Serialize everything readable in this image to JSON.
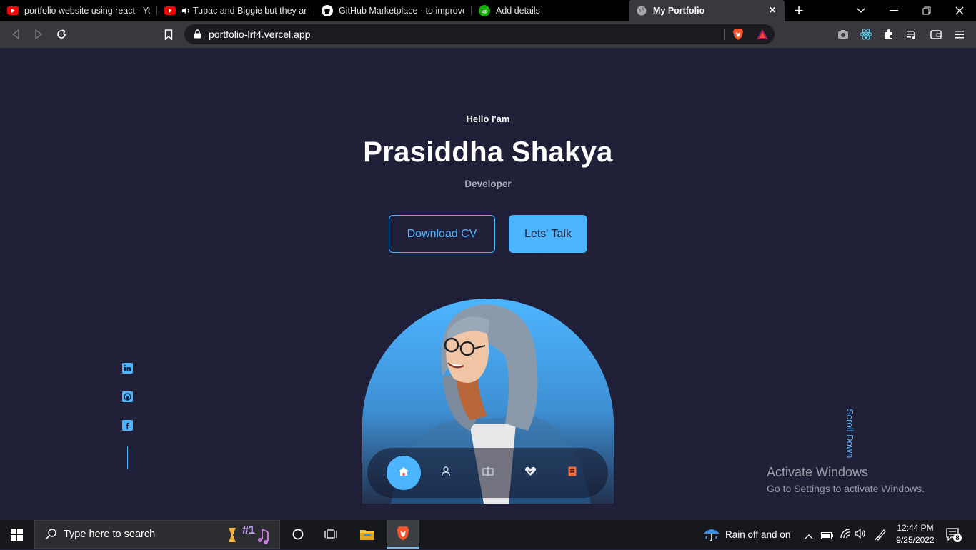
{
  "browser": {
    "tabs": [
      {
        "title": "portfolio website using react - You",
        "icon": "youtube-icon",
        "audio": false,
        "active": false
      },
      {
        "title": "Tupac and Biggie but they are",
        "icon": "youtube-icon",
        "audio": true,
        "active": false
      },
      {
        "title": "GitHub Marketplace · to improve y",
        "icon": "github-icon",
        "audio": false,
        "active": false
      },
      {
        "title": "Add details",
        "icon": "upwork-icon",
        "audio": false,
        "active": false
      },
      {
        "title": "My Portfolio",
        "icon": "globe-icon",
        "audio": false,
        "active": true
      }
    ],
    "new_tab": "+",
    "address": "portfolio-lrf4.vercel.app"
  },
  "hero": {
    "greeting": "Hello I'am",
    "name": "Prasiddha Shakya",
    "role": "Developer",
    "download_cv": "Download CV",
    "lets_talk": "Lets' Talk",
    "scroll_down": "Scroll Down"
  },
  "socials": [
    "linkedin-icon",
    "github-icon",
    "facebook-icon"
  ],
  "nav": [
    "home-icon",
    "user-icon",
    "book-icon",
    "handshake-icon",
    "message-icon"
  ],
  "watermark": {
    "title": "Activate Windows",
    "subtitle": "Go to Settings to activate Windows."
  },
  "taskbar": {
    "search_placeholder": "Type here to search",
    "search_badge": "#1",
    "weather": "Rain off and on",
    "time": "12:44 PM",
    "date": "9/25/2022",
    "notifications": "8"
  },
  "colors": {
    "background": "#1f1f38",
    "accent": "#4db5ff"
  }
}
